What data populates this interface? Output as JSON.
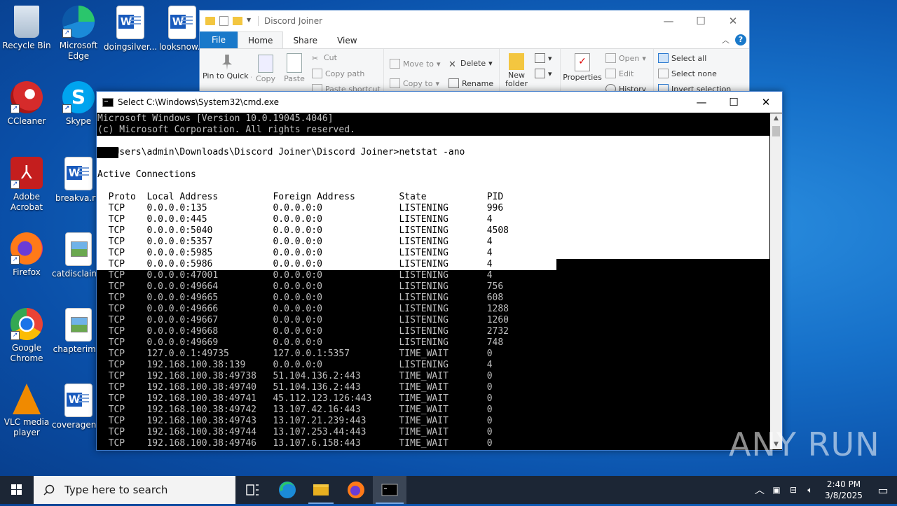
{
  "desktop": {
    "icons": [
      {
        "label": "Recycle Bin",
        "icon": "recycle-bin-icon"
      },
      {
        "label": "Microsoft Edge",
        "icon": "edge-icon"
      },
      {
        "label": "doingsilver...",
        "icon": "word-doc-icon"
      },
      {
        "label": "looksnow...",
        "icon": "word-doc-icon"
      },
      {
        "label": "CCleaner",
        "icon": "ccleaner-icon"
      },
      {
        "label": "Skype",
        "icon": "skype-icon"
      },
      {
        "label": "Adobe Acrobat",
        "icon": "acrobat-icon"
      },
      {
        "label": "breakva.rtf",
        "icon": "word-doc-icon"
      },
      {
        "label": "Firefox",
        "icon": "firefox-icon"
      },
      {
        "label": "catdisclaim...",
        "icon": "image-file-icon"
      },
      {
        "label": "Google Chrome",
        "icon": "chrome-icon"
      },
      {
        "label": "chapterim...",
        "icon": "image-file-icon"
      },
      {
        "label": "VLC media player",
        "icon": "vlc-icon"
      },
      {
        "label": "coveragenc...",
        "icon": "word-doc-icon"
      }
    ]
  },
  "explorer": {
    "title": "Discord Joiner",
    "tabs": [
      "File",
      "Home",
      "Share",
      "View"
    ],
    "active_tab": "Home",
    "ribbon": {
      "pin": "Pin to Quick access",
      "copy": "Copy",
      "paste": "Paste",
      "cut": "Cut",
      "copy_path": "Copy path",
      "paste_shortcut": "Paste shortcut",
      "move_to": "Move to",
      "copy_to": "Copy to",
      "delete": "Delete",
      "rename": "Rename",
      "new_folder": "New folder",
      "properties": "Properties",
      "open": "Open",
      "edit": "Edit",
      "history": "History",
      "select_all": "Select all",
      "select_none": "Select none",
      "invert_selection": "Invert selection"
    }
  },
  "cmd": {
    "title": "Select C:\\Windows\\System32\\cmd.exe",
    "lines": [
      "Microsoft Windows [Version 10.0.19045.4046]",
      "(c) Microsoft Corporation. All rights reserved.",
      "",
      "C:\\Users\\admin\\Downloads\\Discord Joiner\\Discord Joiner>netstat -ano",
      "",
      "Active Connections",
      "",
      "  Proto  Local Address          Foreign Address        State           PID",
      "  TCP    0.0.0.0:135            0.0.0.0:0              LISTENING       996",
      "  TCP    0.0.0.0:445            0.0.0.0:0              LISTENING       4",
      "  TCP    0.0.0.0:5040           0.0.0.0:0              LISTENING       4508",
      "  TCP    0.0.0.0:5357           0.0.0.0:0              LISTENING       4",
      "  TCP    0.0.0.0:5985           0.0.0.0:0              LISTENING       4",
      "  TCP    0.0.0.0:5986           0.0.0.0:0              LISTENING       4",
      "  TCP    0.0.0.0:47001          0.0.0.0:0              LISTENING       4",
      "  TCP    0.0.0.0:49664          0.0.0.0:0              LISTENING       756",
      "  TCP    0.0.0.0:49665          0.0.0.0:0              LISTENING       608",
      "  TCP    0.0.0.0:49666          0.0.0.0:0              LISTENING       1288",
      "  TCP    0.0.0.0:49667          0.0.0.0:0              LISTENING       1260",
      "  TCP    0.0.0.0:49668          0.0.0.0:0              LISTENING       2732",
      "  TCP    0.0.0.0:49669          0.0.0.0:0              LISTENING       748",
      "  TCP    127.0.0.1:49735        127.0.0.1:5357         TIME_WAIT       0",
      "  TCP    192.168.100.38:139     0.0.0.0:0              LISTENING       4",
      "  TCP    192.168.100.38:49738   51.104.136.2:443       TIME_WAIT       0",
      "  TCP    192.168.100.38:49740   51.104.136.2:443       TIME_WAIT       0",
      "  TCP    192.168.100.38:49741   45.112.123.126:443     TIME_WAIT       0",
      "  TCP    192.168.100.38:49742   13.107.42.16:443       TIME_WAIT       0",
      "  TCP    192.168.100.38:49743   13.107.21.239:443      TIME_WAIT       0",
      "  TCP    192.168.100.38:49744   13.107.253.44:443      TIME_WAIT       0",
      "  TCP    192.168.100.38:49746   13.107.6.158:443       TIME_WAIT       0"
    ]
  },
  "taskbar": {
    "search_placeholder": "Type here to search",
    "time": "2:40 PM",
    "date": "3/8/2025"
  },
  "watermark": "ANY RUN"
}
